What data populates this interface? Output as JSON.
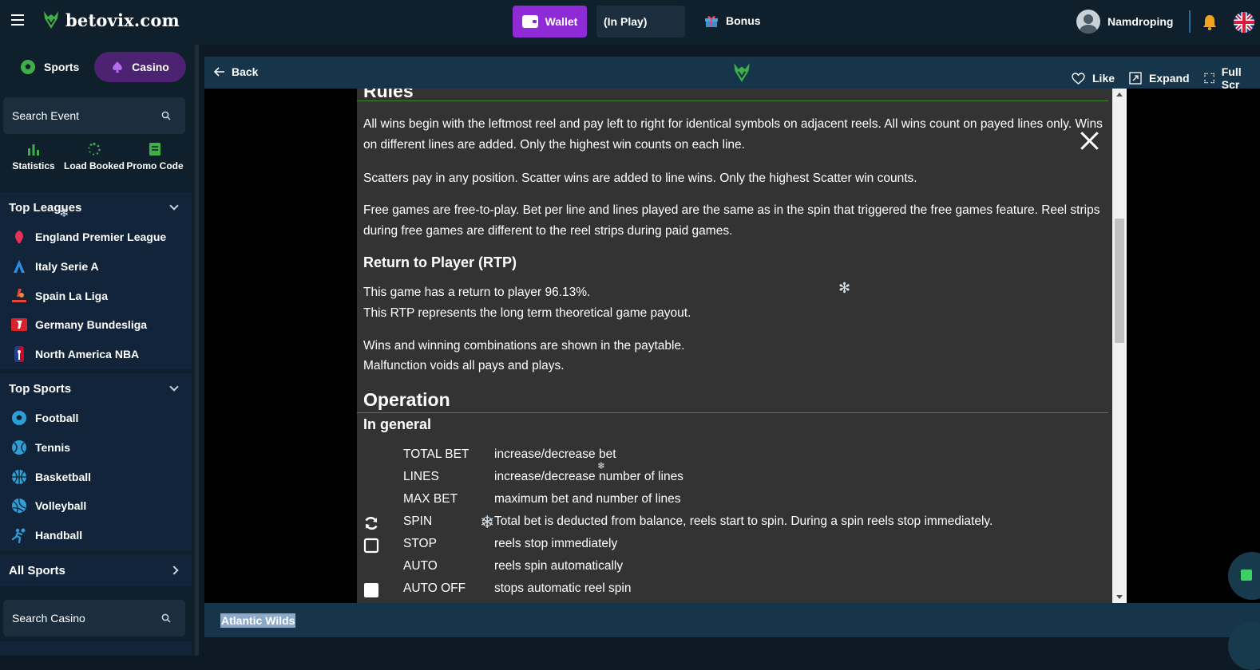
{
  "header": {
    "site_name": "betovix.com",
    "wallet_label": "Wallet",
    "inplay_label": "(In Play)",
    "bonus_label": "Bonus",
    "username": "Namdroping"
  },
  "sidebar": {
    "tabs": [
      {
        "label": "Sports"
      },
      {
        "label": "Casino"
      }
    ],
    "search_event_placeholder": "Search Event",
    "quick_links": [
      {
        "label": "Statistics",
        "icon": "bar-chart-icon"
      },
      {
        "label": "Load Booked",
        "icon": "spinner-icon"
      },
      {
        "label": "Promo Code",
        "icon": "promo-code-icon"
      }
    ],
    "top_leagues_title": "Top Leagues",
    "top_leagues": [
      {
        "label": "England Premier League",
        "icon": "premier-league-icon"
      },
      {
        "label": "Italy Serie A",
        "icon": "serie-a-icon"
      },
      {
        "label": "Spain La Liga",
        "icon": "la-liga-icon"
      },
      {
        "label": "Germany Bundesliga",
        "icon": "bundesliga-icon"
      },
      {
        "label": "North America NBA",
        "icon": "nba-icon"
      }
    ],
    "top_sports_title": "Top Sports",
    "top_sports": [
      {
        "label": "Football",
        "icon": "football-icon"
      },
      {
        "label": "Tennis",
        "icon": "tennis-icon"
      },
      {
        "label": "Basketball",
        "icon": "basketball-icon"
      },
      {
        "label": "Volleyball",
        "icon": "volleyball-icon"
      },
      {
        "label": "Handball",
        "icon": "handball-icon"
      }
    ],
    "all_sports_label": "All Sports",
    "search_casino_placeholder": "Search Casino"
  },
  "game_bar": {
    "back_label": "Back",
    "like_label": "Like",
    "expand_label": "Expand",
    "fullscreen_label": "Full Scr"
  },
  "rules": {
    "heading": "Rules",
    "p1": "All wins begin with the leftmost reel and pay left to right for identical symbols on adjacent reels. All wins count on payed lines only. Wins on different lines are added. Only the highest win counts on each line.",
    "p2": "Scatters pay in any position. Scatter wins are added to line wins. Only the highest Scatter win counts.",
    "p3": "Free games are free-to-play. Bet per line and lines played are the same as in the spin that triggered the free games feature. Reel strips during free games are different to the reel strips during paid games.",
    "rtp_heading": "Return to Player (RTP)",
    "rtp_line1": "This game has a return to player 96.13%.",
    "rtp_line2": "This RTP represents the long term theoretical game payout.",
    "wins_line1": "Wins and winning combinations are shown in the paytable.",
    "wins_line2": "Malfunction voids all pays and plays.",
    "operation_heading": "Operation",
    "general_heading": "In general",
    "operations": [
      {
        "key": "TOTAL BET",
        "value": "increase/decrease bet",
        "icon": ""
      },
      {
        "key": "LINES",
        "value": "increase/decrease number of lines",
        "icon": ""
      },
      {
        "key": "MAX BET",
        "value": "maximum bet and number of lines",
        "icon": ""
      },
      {
        "key": "SPIN",
        "value": "Total bet is deducted from balance, reels start to spin. During a spin reels stop immediately.",
        "icon": "spin-icon"
      },
      {
        "key": "STOP",
        "value": "reels stop immediately",
        "icon": "stop-icon"
      },
      {
        "key": "AUTO",
        "value": "reels spin automatically",
        "icon": ""
      },
      {
        "key": "AUTO OFF",
        "value": "stops automatic reel spin",
        "icon": "auto-off-icon"
      }
    ]
  },
  "footer": {
    "game_title": "Atlantic Wilds"
  },
  "colors": {
    "accent_purple": "#8e2bd6",
    "casino_tab": "#4b2370",
    "sidebar_bg": "#0f1f2c",
    "rule_line": "#3f8a2f"
  }
}
